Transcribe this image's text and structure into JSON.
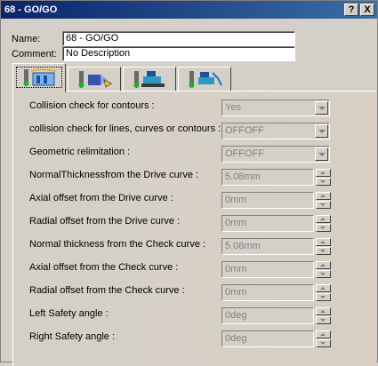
{
  "window": {
    "title": "68 - GO/GO",
    "help_label": "?",
    "close_label": "X"
  },
  "name_field": {
    "label": "Name:",
    "value": "68 - GO/GO"
  },
  "comment_field": {
    "label": "Comment:",
    "value": "No Description"
  },
  "tabs": [
    {
      "icon": "geometry-strategy-icon",
      "active": true
    },
    {
      "icon": "tool-strategy-icon",
      "active": false
    },
    {
      "icon": "feedrate-icon",
      "active": false
    },
    {
      "icon": "macro-icon",
      "active": false
    }
  ],
  "rows": [
    {
      "label": "Collision check for contours :",
      "type": "combo",
      "value": "Yes"
    },
    {
      "label": "collision check for lines, curves or contours :",
      "type": "combo",
      "value": "OFFOFF"
    },
    {
      "label": "Geometric relimitation :",
      "type": "combo",
      "value": "OFFOFF"
    },
    {
      "label": "NormalThicknessfrom the Drive curve :",
      "type": "spin",
      "value": "5.08mm"
    },
    {
      "label": "Axial offset from the Drive curve :",
      "type": "spin",
      "value": "0mm"
    },
    {
      "label": "Radial offset from the Drive curve :",
      "type": "spin",
      "value": "0mm"
    },
    {
      "label": "Normal thickness from the Check curve :",
      "type": "spin",
      "value": "5.08mm"
    },
    {
      "label": "Axial offset from the Check curve :",
      "type": "spin",
      "value": "0mm"
    },
    {
      "label": "Radial offset from the Check curve :",
      "type": "spin",
      "value": "0mm"
    },
    {
      "label": "Left Safety angle :",
      "type": "spin",
      "value": "0deg"
    },
    {
      "label": "Right Safety angle :",
      "type": "spin",
      "value": "0deg"
    }
  ],
  "colors": {
    "title_bar": "#0a246a",
    "face": "#d4d0c8",
    "disabled_text": "#808080"
  }
}
